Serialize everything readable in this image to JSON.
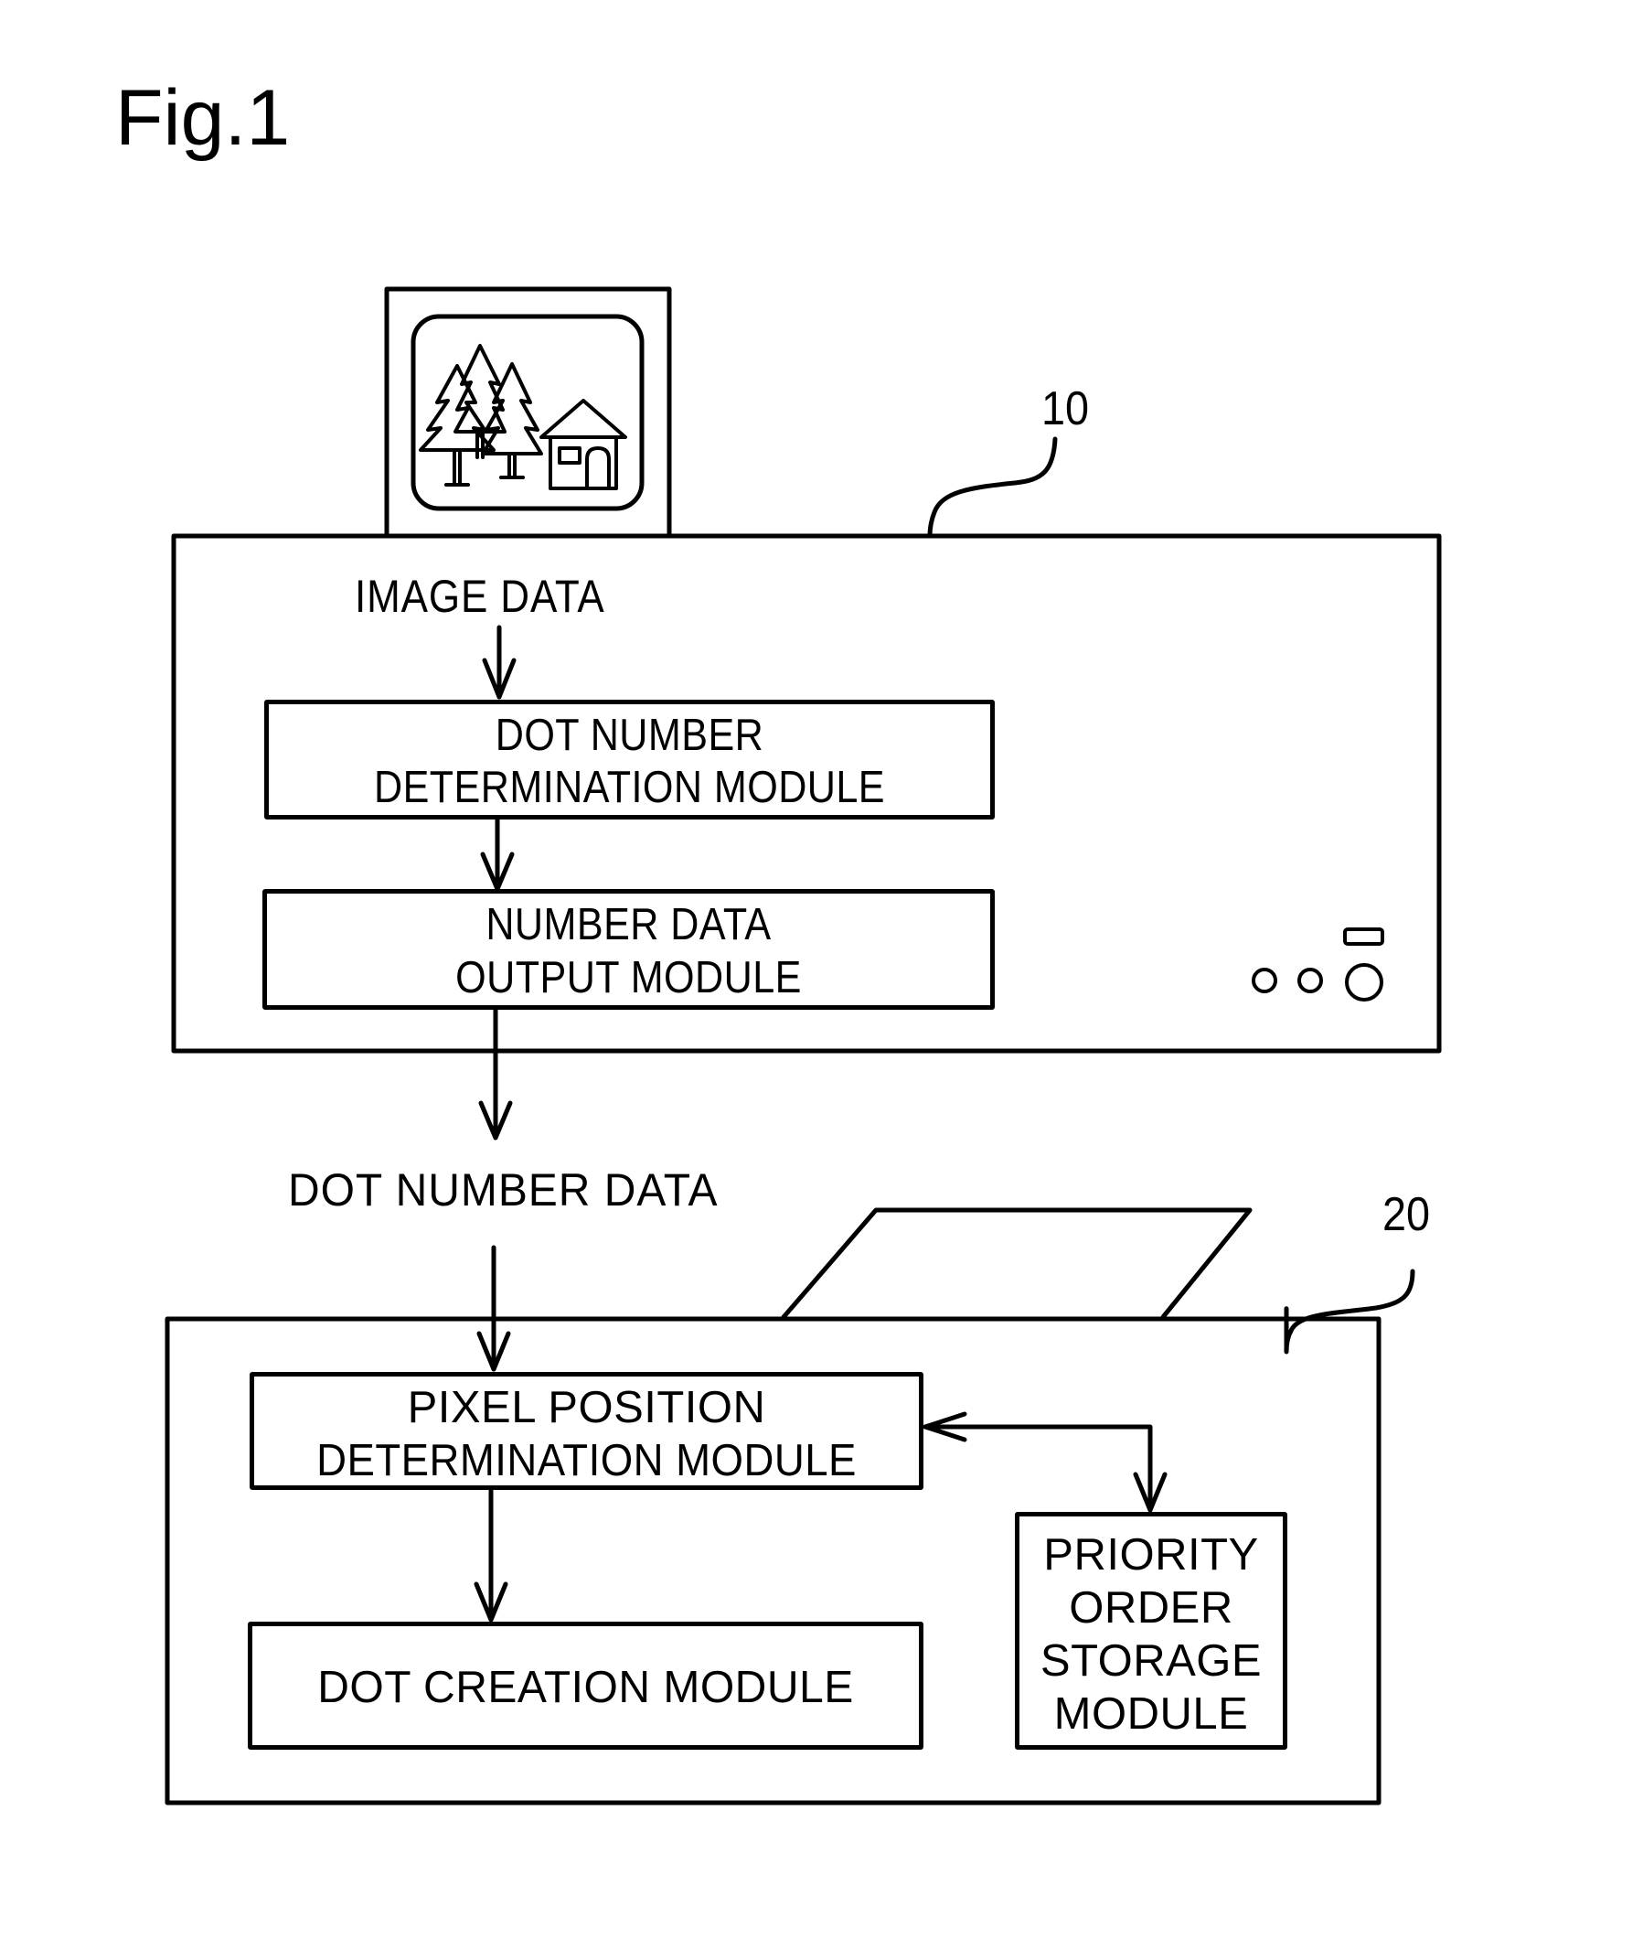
{
  "figure": {
    "title": "Fig.1"
  },
  "device_10": {
    "reference_numeral": "10",
    "input_label": "IMAGE DATA",
    "modules": [
      {
        "lines": [
          "DOT NUMBER",
          "DETERMINATION MODULE"
        ]
      },
      {
        "lines": [
          "NUMBER DATA",
          "OUTPUT MODULE"
        ]
      }
    ],
    "indicator_icons": [
      "power-button-icon",
      "indicator-light-icon",
      "indicator-light-icon",
      "display-slot-icon"
    ]
  },
  "transfer": {
    "label": "DOT NUMBER DATA"
  },
  "device_20": {
    "reference_numeral": "20",
    "modules": [
      {
        "lines": [
          "PIXEL POSITION",
          "DETERMINATION MODULE"
        ]
      },
      {
        "lines": [
          "DOT CREATION MODULE"
        ]
      },
      {
        "lines": [
          "PRIORITY",
          "ORDER",
          "STORAGE",
          "MODULE"
        ]
      }
    ]
  },
  "monitor": {
    "icon": "landscape-trees-house-icon"
  }
}
